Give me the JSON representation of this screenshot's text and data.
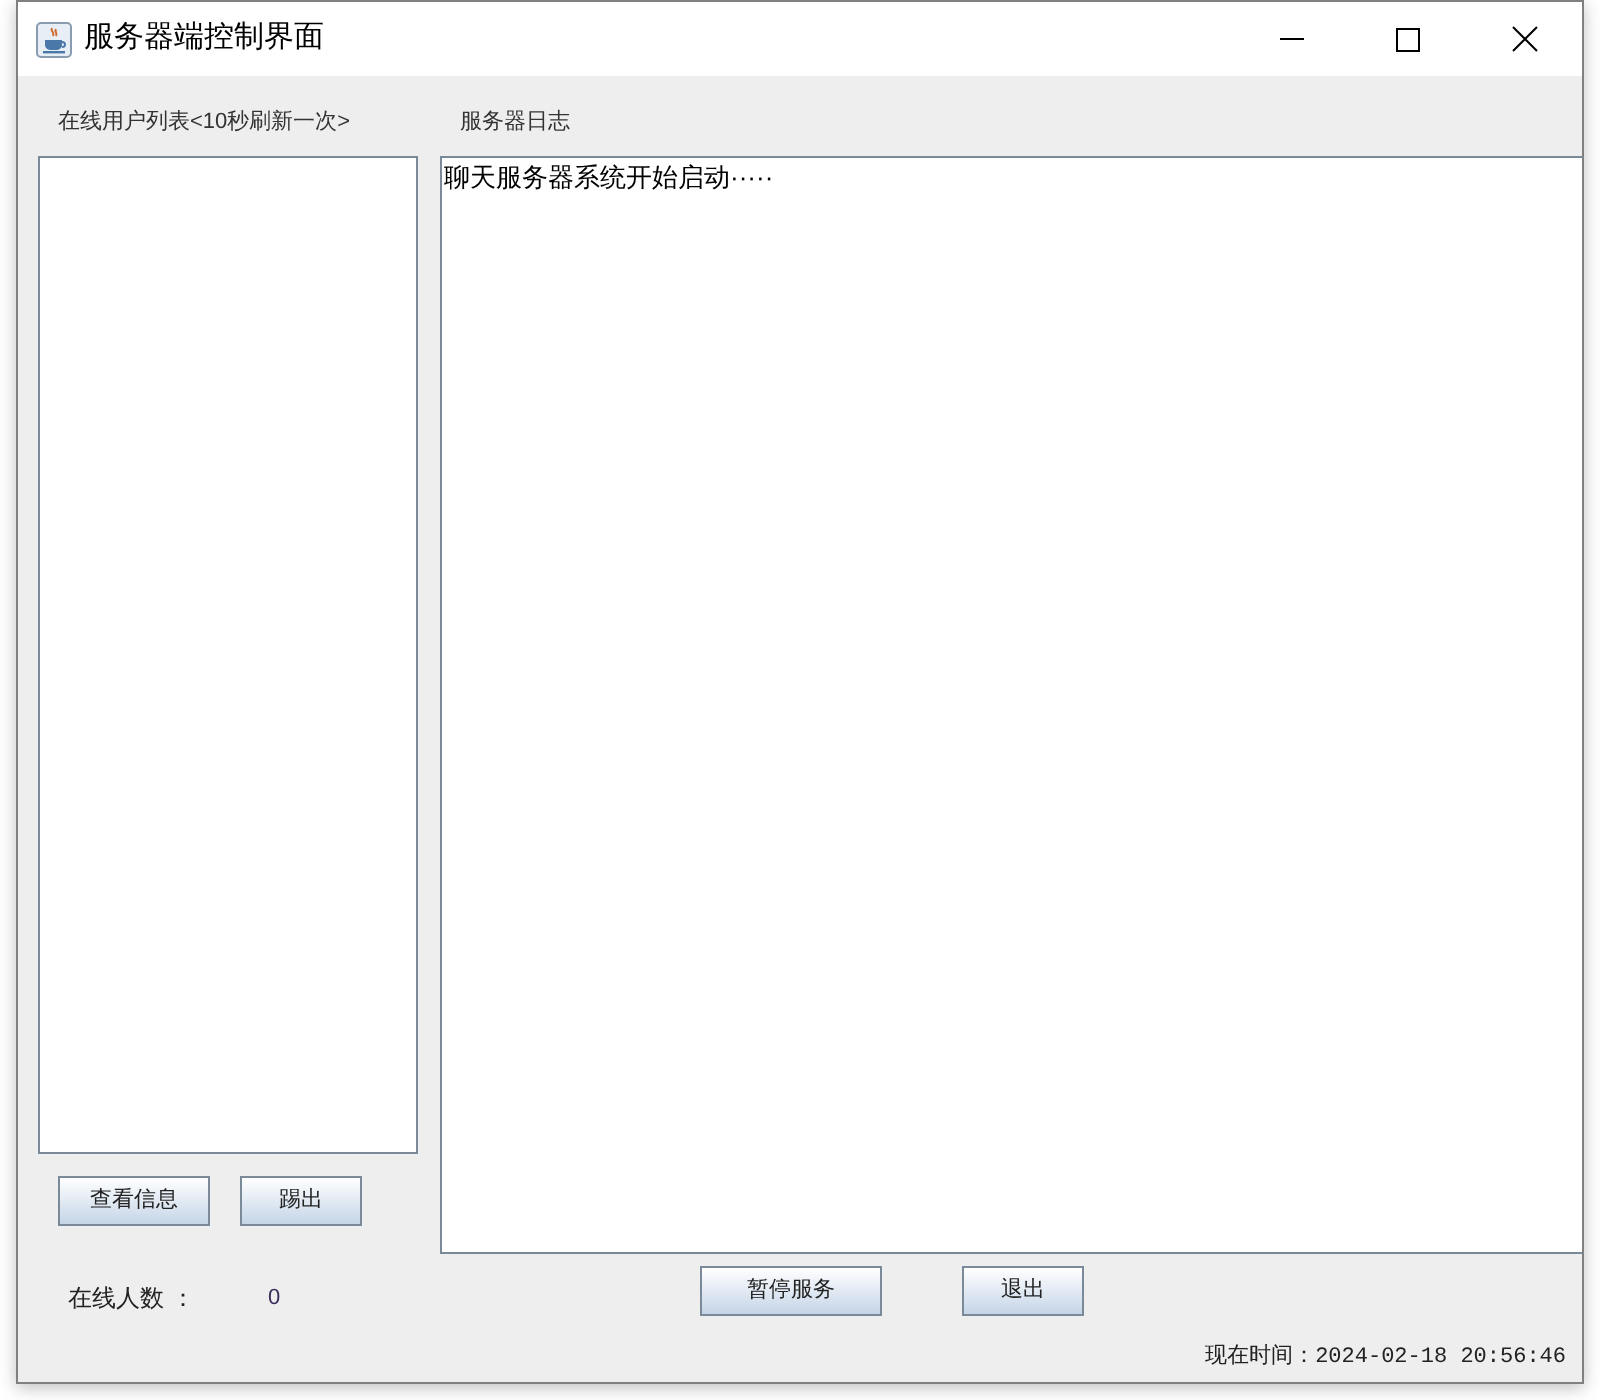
{
  "window": {
    "title": "服务器端控制界面"
  },
  "online_users": {
    "label": "在线用户列表<10秒刷新一次>"
  },
  "server_log": {
    "label": "服务器日志",
    "lines": [
      "聊天服务器系统开始启动·····"
    ]
  },
  "user_buttons": [
    "查看信息",
    "踢出"
  ],
  "online_count": {
    "label": "在线人数 ：",
    "value": "0"
  },
  "server_buttons": [
    "暂停服务",
    "退出"
  ],
  "clock": {
    "text": "现在时间：2024-02-18 20:56:46"
  }
}
